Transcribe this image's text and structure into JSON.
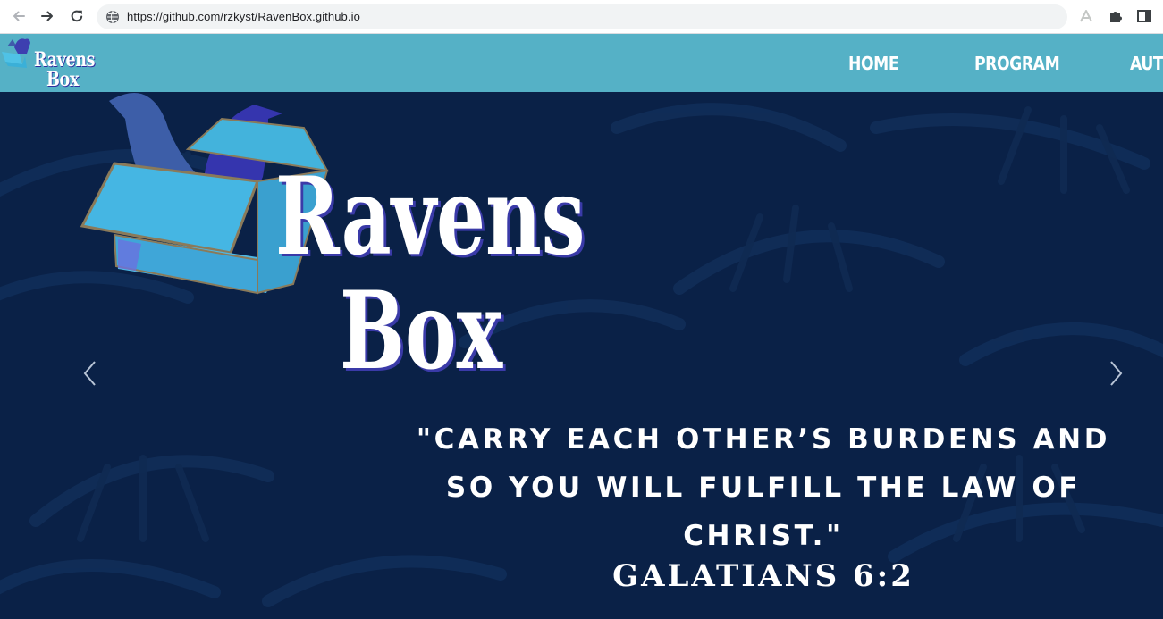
{
  "browser": {
    "url": "https://github.com/rzkyst/RavenBox.github.io",
    "icons": [
      "back-arrow-icon",
      "forward-arrow-icon",
      "reload-icon",
      "site-info-icon",
      "reader-icon",
      "extensions-icon",
      "sidepanel-icon"
    ]
  },
  "header": {
    "logo": {
      "line1": "Ravens",
      "line2": "Box"
    },
    "nav": [
      "HOME",
      "PROGRAM",
      "AUTH"
    ],
    "background_color": "#55b1c6"
  },
  "hero": {
    "logo": {
      "line1": "Ravens",
      "line2": "Box"
    },
    "quote": "\"CARRY EACH OTHER’S BURDENS AND SO YOU WILL FULFILL THE LAW OF CHRIST.\"",
    "reference": "GALATIANS 6:2",
    "background_color": "#0a2147",
    "prev_icon": "chevron-left-icon",
    "next_icon": "chevron-right-icon"
  }
}
